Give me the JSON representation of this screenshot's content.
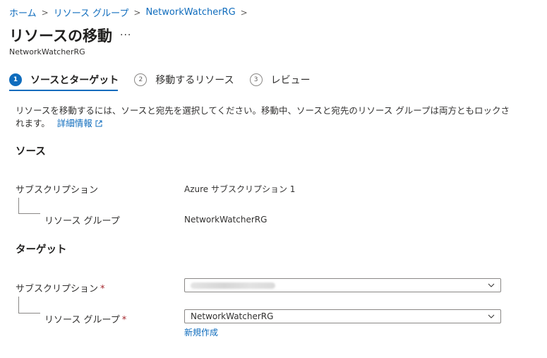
{
  "breadcrumb": {
    "items": [
      "ホーム",
      "リソース グループ",
      "NetworkWatcherRG"
    ],
    "separator": ">"
  },
  "header": {
    "title": "リソースの移動",
    "more_label": "...",
    "subtitle": "NetworkWatcherRG"
  },
  "steps": [
    {
      "number": "1",
      "label": "ソースとターゲット",
      "active": true
    },
    {
      "number": "2",
      "label": "移動するリソース",
      "active": false
    },
    {
      "number": "3",
      "label": "レビュー",
      "active": false
    }
  ],
  "description": {
    "text": "リソースを移動するには、ソースと宛先を選択してください。移動中、ソースと宛先のリソース グループは両方ともロックされます。",
    "link": "詳細情報",
    "link_icon": "external-link-icon"
  },
  "source": {
    "heading": "ソース",
    "subscription_label": "サブスクリプション",
    "subscription_value": "Azure サブスクリプション 1",
    "resource_group_label": "リソース グループ",
    "resource_group_value": "NetworkWatcherRG"
  },
  "target": {
    "heading": "ターゲット",
    "subscription_label": "サブスクリプション",
    "required_mark": "*",
    "subscription_value": "",
    "resource_group_label": "リソース グループ",
    "resource_group_value": "NetworkWatcherRG",
    "create_new_link": "新規作成"
  },
  "colors": {
    "accent": "#0f6cbd",
    "required": "#a4262c",
    "text": "#323130"
  }
}
